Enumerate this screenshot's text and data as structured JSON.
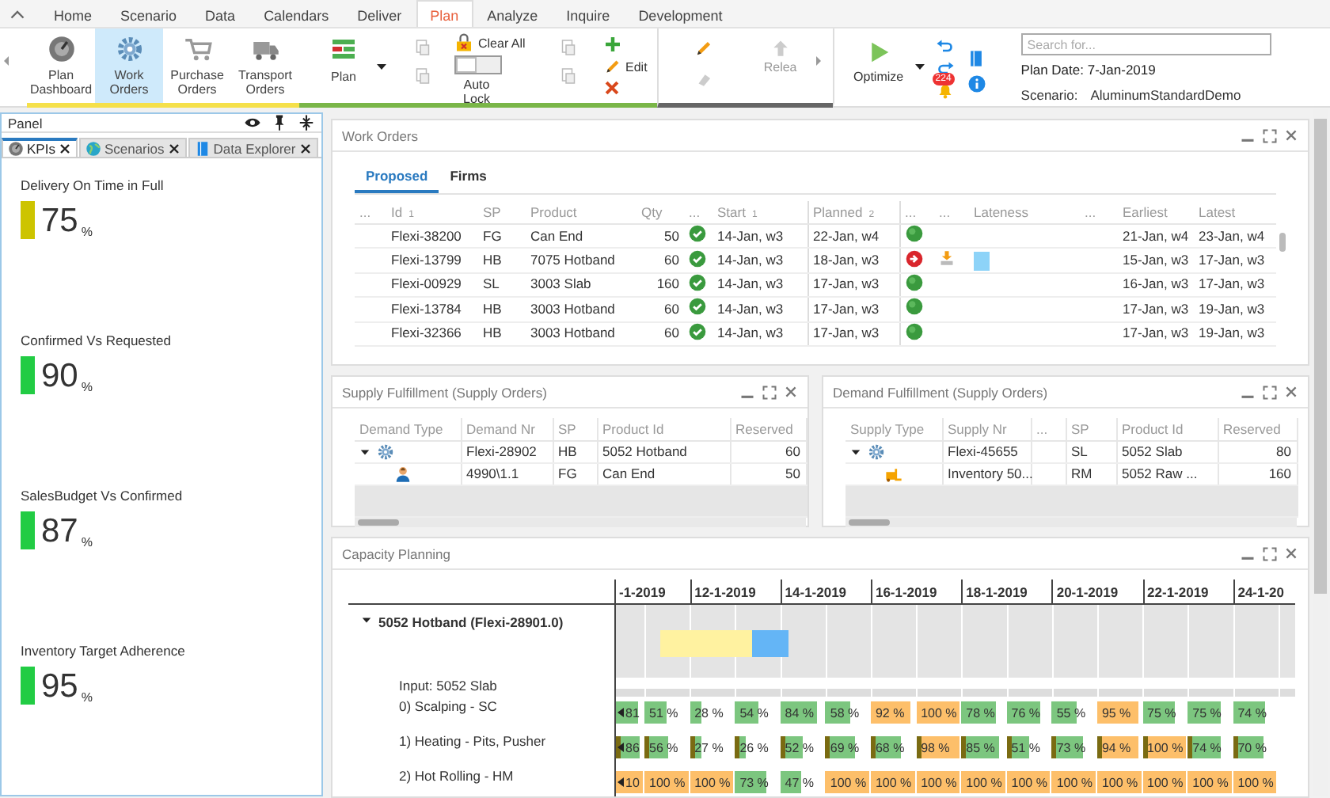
{
  "menu_tabs": [
    {
      "label": "Home",
      "selected": false
    },
    {
      "label": "Scenario",
      "selected": false
    },
    {
      "label": "Data",
      "selected": false
    },
    {
      "label": "Calendars",
      "selected": false
    },
    {
      "label": "Deliver",
      "selected": false
    },
    {
      "label": "Plan",
      "selected": true
    },
    {
      "label": "Analyze",
      "selected": false
    },
    {
      "label": "Inquire",
      "selected": false
    },
    {
      "label": "Development",
      "selected": false
    }
  ],
  "ribbon": {
    "nav": [
      {
        "label": "Plan Dashboard",
        "selected": false
      },
      {
        "label": "Work Orders",
        "selected": true
      },
      {
        "label": "Purchase Orders",
        "selected": false
      },
      {
        "label": "Transport Orders",
        "selected": false
      }
    ],
    "plan_button": "Plan",
    "clear_all": "Clear All",
    "auto_lock": {
      "label": "Auto Lock",
      "on": false
    },
    "edit": "Edit",
    "release": {
      "label": "Relea",
      "disabled": true
    },
    "optimize": "Optimize",
    "notifications": "224",
    "search": {
      "placeholder": "Search for..."
    },
    "plan_date": "Plan Date: 7-Jan-2019",
    "scenario_label": "Scenario:",
    "scenario": "AluminumStandardDemo"
  },
  "panel": {
    "title": "Panel",
    "tabs": [
      {
        "label": "KPIs",
        "selected": true
      },
      {
        "label": "Scenarios",
        "selected": false
      },
      {
        "label": "Data Explorer",
        "selected": false
      }
    ],
    "kpis": [
      {
        "title": "Delivery On Time in Full",
        "value": "75",
        "unit": "%",
        "color": "#cdc400"
      },
      {
        "title": "Confirmed Vs Requested",
        "value": "90",
        "unit": "%",
        "color": "#22cc44"
      },
      {
        "title": "SalesBudget Vs Confirmed",
        "value": "87",
        "unit": "%",
        "color": "#22cc44"
      },
      {
        "title": "Inventory Target Adherence",
        "value": "95",
        "unit": "%",
        "color": "#22cc44"
      }
    ]
  },
  "work_orders": {
    "title": "Work Orders",
    "tabs": [
      {
        "label": "Proposed",
        "selected": true
      },
      {
        "label": "Firms",
        "selected": false
      }
    ],
    "columns": [
      {
        "label": "..."
      },
      {
        "label": "Id",
        "sort": "1"
      },
      {
        "label": "SP"
      },
      {
        "label": "Product"
      },
      {
        "label": "Qty"
      },
      {
        "label": "..."
      },
      {
        "label": "Start",
        "sort": "1"
      },
      {
        "label": "Planned",
        "sort": "2"
      },
      {
        "label": "..."
      },
      {
        "label": "..."
      },
      {
        "label": "Lateness"
      },
      {
        "label": "..."
      },
      {
        "label": "Earliest"
      },
      {
        "label": "Latest"
      }
    ],
    "rows": [
      {
        "id": "Flexi-38200",
        "sp": "FG",
        "product": "Can End",
        "qty": "50",
        "start": "14-Jan, w3",
        "planned": "22-Jan, w4",
        "late": false,
        "earliest": "21-Jan, w4",
        "latest": "23-Jan, w4"
      },
      {
        "id": "Flexi-13799",
        "sp": "HB",
        "product": "7075 Hotband",
        "qty": "60",
        "start": "14-Jan, w3",
        "planned": "18-Jan, w3",
        "late": true,
        "earliest": "15-Jan, w3",
        "latest": "17-Jan, w3"
      },
      {
        "id": "Flexi-00929",
        "sp": "SL",
        "product": "3003 Slab",
        "qty": "160",
        "start": "14-Jan, w3",
        "planned": "17-Jan, w3",
        "late": false,
        "earliest": "16-Jan, w3",
        "latest": "17-Jan, w3"
      },
      {
        "id": "Flexi-13784",
        "sp": "HB",
        "product": "3003 Hotband",
        "qty": "60",
        "start": "14-Jan, w3",
        "planned": "17-Jan, w3",
        "late": false,
        "earliest": "17-Jan, w3",
        "latest": "19-Jan, w3"
      },
      {
        "id": "Flexi-32366",
        "sp": "HB",
        "product": "3003 Hotband",
        "qty": "60",
        "start": "14-Jan, w3",
        "planned": "17-Jan, w3",
        "late": false,
        "earliest": "17-Jan, w3",
        "latest": "19-Jan, w3"
      }
    ]
  },
  "supply_fulfillment": {
    "title": "Supply Fulfillment (Supply Orders)",
    "columns": [
      {
        "label": "Demand Type"
      },
      {
        "label": "Demand Nr"
      },
      {
        "label": "SP"
      },
      {
        "label": "Product Id"
      },
      {
        "label": "Reserved"
      }
    ],
    "rows": [
      {
        "kind": "order",
        "nr": "Flexi-28902",
        "sp": "HB",
        "product": "5052 Hotband",
        "reserved": "60",
        "expanded": true,
        "children": [
          {
            "kind": "customer",
            "nr": "4990\\1.1",
            "sp": "FG",
            "product": "Can End",
            "reserved": "50"
          }
        ]
      }
    ]
  },
  "demand_fulfillment": {
    "title": "Demand Fulfillment (Supply Orders)",
    "columns": [
      {
        "label": "Supply Type"
      },
      {
        "label": "Supply Nr"
      },
      {
        "label": "..."
      },
      {
        "label": "SP"
      },
      {
        "label": "Product Id"
      },
      {
        "label": "Reserved"
      }
    ],
    "rows": [
      {
        "kind": "order",
        "nr": "Flexi-45655",
        "sp": "SL",
        "product": "5052 Slab",
        "reserved": "80",
        "expanded": true,
        "children": [
          {
            "kind": "stock",
            "nr": "Inventory 50...",
            "sp": "RM",
            "product": "5052 Raw ...",
            "reserved": "160"
          }
        ]
      }
    ]
  },
  "capacity": {
    "title": "Capacity Planning",
    "dates": [
      "-1-2019",
      "12-1-2019",
      "14-1-2019",
      "16-1-2019",
      "18-1-2019",
      "20-1-2019",
      "22-1-2019",
      "24-1-20"
    ],
    "group": {
      "label": "5052 Hotband (Flexi-28901.0)",
      "expanded": true
    },
    "input": "Input: 5052 Slab",
    "resources": [
      {
        "label": "0) Scalping - SC",
        "setup": false,
        "cells": [
          {
            "text": "81",
            "level": 0.81,
            "high": false
          },
          {
            "text": "51 %",
            "level": 0.51,
            "high": false
          },
          {
            "text": "28 %",
            "level": 0.28,
            "high": false
          },
          {
            "text": "54 %",
            "level": 0.54,
            "high": false
          },
          {
            "text": "84 %",
            "level": 0.84,
            "high": false
          },
          {
            "text": "58 %",
            "level": 0.58,
            "high": false
          },
          {
            "text": "92 %",
            "level": 0.92,
            "high": true
          },
          {
            "text": "100 %",
            "level": 1,
            "high": true
          },
          {
            "text": "78 %",
            "level": 0.78,
            "high": false
          },
          {
            "text": "76 %",
            "level": 0.76,
            "high": false
          },
          {
            "text": "55 %",
            "level": 0.55,
            "high": false
          },
          {
            "text": "95 %",
            "level": 0.95,
            "high": true
          },
          {
            "text": "75 %",
            "level": 0.75,
            "high": false
          },
          {
            "text": "75 %",
            "level": 0.75,
            "high": false
          },
          {
            "text": "74 %",
            "level": 0.74,
            "high": false
          }
        ]
      },
      {
        "label": "1) Heating - Pits, Pusher",
        "setup": true,
        "cells": [
          {
            "text": "86",
            "level": 0.86,
            "high": false
          },
          {
            "text": "56 %",
            "level": 0.56,
            "high": false
          },
          {
            "text": "27 %",
            "level": 0.27,
            "high": false
          },
          {
            "text": "26 %",
            "level": 0.26,
            "high": false
          },
          {
            "text": "52 %",
            "level": 0.52,
            "high": false
          },
          {
            "text": "69 %",
            "level": 0.69,
            "high": false
          },
          {
            "text": "68 %",
            "level": 0.68,
            "high": false
          },
          {
            "text": "98 %",
            "level": 0.98,
            "high": true
          },
          {
            "text": "85 %",
            "level": 0.85,
            "high": false
          },
          {
            "text": "51 %",
            "level": 0.51,
            "high": false
          },
          {
            "text": "73 %",
            "level": 0.73,
            "high": false
          },
          {
            "text": "94 %",
            "level": 0.94,
            "high": true
          },
          {
            "text": "100 %",
            "level": 1,
            "high": true
          },
          {
            "text": "74 %",
            "level": 0.74,
            "high": false
          },
          {
            "text": "70 %",
            "level": 0.7,
            "high": false
          }
        ]
      },
      {
        "label": "2) Hot Rolling - HM",
        "setup": false,
        "cells": [
          {
            "text": "10",
            "level": 1,
            "high": true
          },
          {
            "text": "100 %",
            "level": 1,
            "high": true
          },
          {
            "text": "100 %",
            "level": 1,
            "high": true
          },
          {
            "text": "73 %",
            "level": 0.73,
            "high": false
          },
          {
            "text": "47 %",
            "level": 0.47,
            "high": false
          },
          {
            "text": "100 %",
            "level": 1,
            "high": true
          },
          {
            "text": "100 %",
            "level": 1,
            "high": true
          },
          {
            "text": "100 %",
            "level": 1,
            "high": true
          },
          {
            "text": "100 %",
            "level": 1,
            "high": true
          },
          {
            "text": "100 %",
            "level": 1,
            "high": true
          },
          {
            "text": "100 %",
            "level": 1,
            "high": true
          },
          {
            "text": "100 %",
            "level": 1,
            "high": true
          },
          {
            "text": "100 %",
            "level": 1,
            "high": true
          },
          {
            "text": "100 %",
            "level": 1,
            "high": true
          },
          {
            "text": "100 %",
            "level": 1,
            "high": true
          }
        ]
      }
    ]
  }
}
